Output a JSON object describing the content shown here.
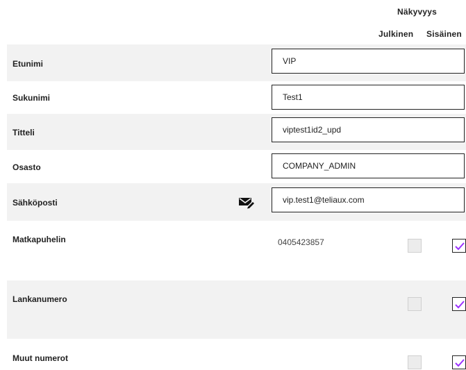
{
  "header": {
    "visibility": "Näkyvyys",
    "public": "Julkinen",
    "internal": "Sisäinen"
  },
  "fields": [
    {
      "label": "Etunimi",
      "value": "VIP"
    },
    {
      "label": "Sukunimi",
      "value": "Test1"
    },
    {
      "label": "Titteli",
      "value": "viptest1id2_upd"
    },
    {
      "label": "Osasto",
      "value": "COMPANY_ADMIN"
    },
    {
      "label": "Sähköposti",
      "value": "vip.test1@teliaux.com",
      "icon": "email-edit-icon"
    }
  ],
  "phones": [
    {
      "label": "Matkapuhelin",
      "value": "0405423857",
      "public": false,
      "internal": true
    },
    {
      "label": "Lankanumero",
      "value": "",
      "public": false,
      "internal": true
    },
    {
      "label": "Muut numerot",
      "value": "",
      "public": false,
      "internal": true
    }
  ],
  "colors": {
    "check": "#9b30ff",
    "shade": "#f2f2f2"
  }
}
